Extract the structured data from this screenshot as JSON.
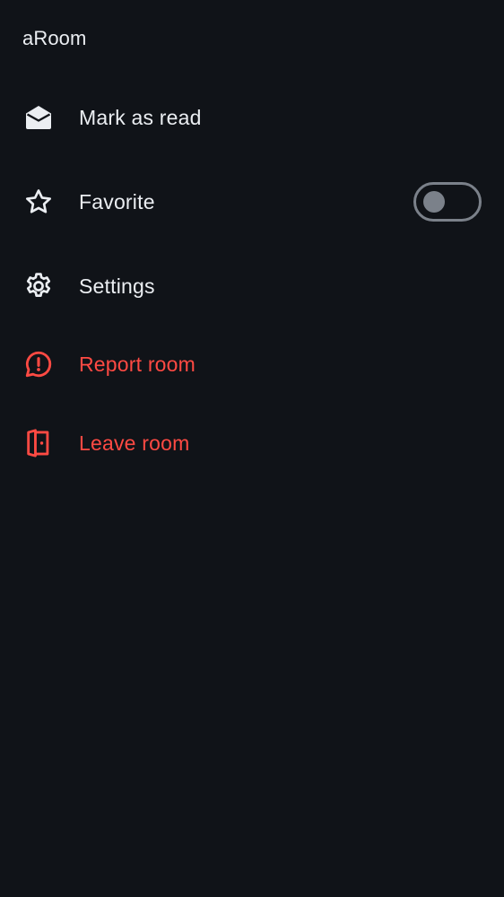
{
  "room": {
    "title": "aRoom"
  },
  "menu": {
    "items": [
      {
        "id": "mark-as-read",
        "label": "Mark as read",
        "icon": "envelope-open-icon",
        "critical": false
      },
      {
        "id": "favorite",
        "label": "Favorite",
        "icon": "star-icon",
        "critical": false,
        "toggle": {
          "on": false
        }
      },
      {
        "id": "settings",
        "label": "Settings",
        "icon": "gear-icon",
        "critical": false
      },
      {
        "id": "report-room",
        "label": "Report room",
        "icon": "report-bubble-icon",
        "critical": true
      },
      {
        "id": "leave-room",
        "label": "Leave room",
        "icon": "leave-door-icon",
        "critical": true
      }
    ]
  },
  "colors": {
    "background": "#101318",
    "text": "#ebeef2",
    "critical": "#ff4a43",
    "toggle_off": "#7b818a"
  }
}
